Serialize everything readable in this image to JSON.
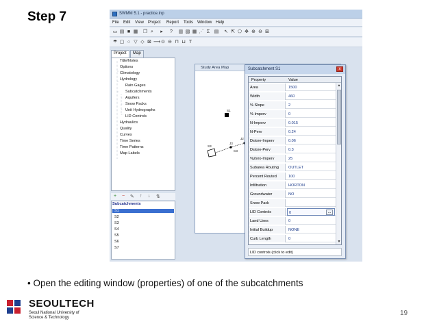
{
  "slide": {
    "title": "Step 7",
    "bullet": "• Open the editing window (properties) of one of the subcatchments",
    "page_number": "19",
    "logo_name": "SEOULTECH",
    "logo_sub_line1": "Seoul National University of",
    "logo_sub_line2": "Science & Technology"
  },
  "app": {
    "title": "SWMM 5.1 - practice.inp",
    "menus": [
      "File",
      "Edit",
      "View",
      "Project",
      "Report",
      "Tools",
      "Window",
      "Help"
    ]
  },
  "browser": {
    "tabs": [
      "Project",
      "Map"
    ],
    "tree": [
      "Title/Notes",
      "Options",
      "Climatology",
      "Hydrology",
      "Rain Gages",
      "Subcatchments",
      "Aquifers",
      "Snow Packs",
      "Unit Hydrographs",
      "LID Controls",
      "Hydraulics",
      "Quality",
      "Curves",
      "Time Series",
      "Time Patterns",
      "Map Labels"
    ],
    "objects_header": "Subcatchments",
    "objects": [
      "S1",
      "S2",
      "S3",
      "S4",
      "S5",
      "S6",
      "S7"
    ]
  },
  "map": {
    "title": "Study Area Map",
    "labels": [
      "S1",
      "J3",
      "S3",
      "C3",
      "J2",
      "J1",
      "S2",
      "S5"
    ]
  },
  "properties": {
    "title": "Subcatchment S1",
    "close_label": "x",
    "col_property": "Property",
    "col_value": "Value",
    "rows": [
      {
        "k": "Area",
        "v": "1500"
      },
      {
        "k": "Width",
        "v": "460"
      },
      {
        "k": "% Slope",
        "v": "2"
      },
      {
        "k": "% Imperv",
        "v": "0"
      },
      {
        "k": "N-Imperv",
        "v": "0.015"
      },
      {
        "k": "N-Perv",
        "v": "0.24"
      },
      {
        "k": "Dstore-Imperv",
        "v": "0.06"
      },
      {
        "k": "Dstore-Perv",
        "v": "0.3"
      },
      {
        "k": "%Zero-Imperv",
        "v": "25"
      },
      {
        "k": "Subarea Routing",
        "v": "OUTLET"
      },
      {
        "k": "Percent Routed",
        "v": "100"
      },
      {
        "k": "Infiltration",
        "v": "HORTON"
      },
      {
        "k": "Groundwater",
        "v": "NO"
      },
      {
        "k": "Snow Pack",
        "v": ""
      },
      {
        "k": "LID Controls",
        "v": "0"
      },
      {
        "k": "Land Uses",
        "v": "0"
      },
      {
        "k": "Initial Buildup",
        "v": "NONE"
      },
      {
        "k": "Curb Length",
        "v": "0"
      }
    ],
    "ellipsis": "...",
    "hint": "LID controls (click to edit)"
  },
  "colors": {
    "selection": "#3a6fd0",
    "logo_red": "#c8202f",
    "logo_blue": "#1f3f8f"
  }
}
